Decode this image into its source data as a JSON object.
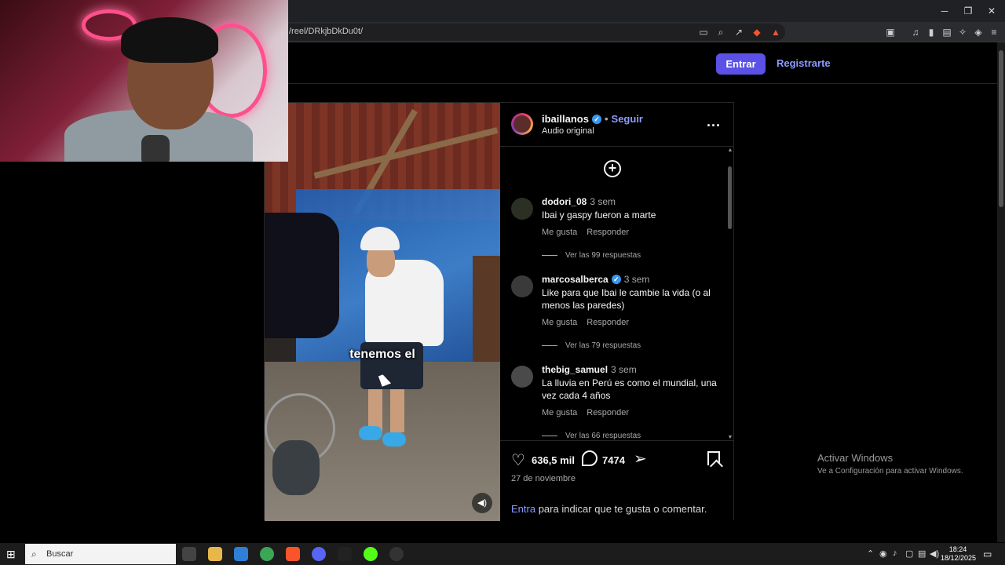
{
  "browser": {
    "url": "/reel/DRkjbDkDu0t/",
    "window_controls": [
      "─",
      "❐",
      "✕"
    ]
  },
  "header": {
    "login_label": "Entrar",
    "register_label": "Registrarte"
  },
  "post": {
    "author": "ibaillanos",
    "separator": "•",
    "follow_label": "Seguir",
    "audio_label": "Audio original",
    "more_label": "...",
    "video_caption": "tenemos el",
    "likes": "636,5 mil",
    "comments_count": "7474",
    "date": "27 de noviembre",
    "login_link": "Entra",
    "login_prompt": " para indicar que te gusta o comentar."
  },
  "comments": [
    {
      "user": "dodori_08",
      "verified": false,
      "time": "3 sem",
      "text": "Ibai y gaspy fueron a marte",
      "like_label": "Me gusta",
      "reply_label": "Responder",
      "replies_label": "Ver las 99 respuestas"
    },
    {
      "user": "marcosalberca",
      "verified": true,
      "time": "3 sem",
      "text": "Like para que Ibai le cambie la vida (o al menos las paredes)",
      "like_label": "Me gusta",
      "reply_label": "Responder",
      "replies_label": "Ver las 79 respuestas"
    },
    {
      "user": "thebig_samuel",
      "verified": false,
      "time": "3 sem",
      "text": "La lluvia en Perú es como el mundial, una vez cada 4 años",
      "like_label": "Me gusta",
      "reply_label": "Responder",
      "replies_label": "Ver las 66 respuestas"
    }
  ],
  "windows_watermark": {
    "title": "Activar Windows",
    "subtitle": "Ve a Configuración para activar Windows."
  },
  "taskbar": {
    "search_placeholder": "Buscar",
    "time": "18:24",
    "date": "18/12/2025"
  },
  "colors": {
    "accent_button": "#5b51e6",
    "link": "#8c9bff",
    "verified": "#3897f0"
  }
}
